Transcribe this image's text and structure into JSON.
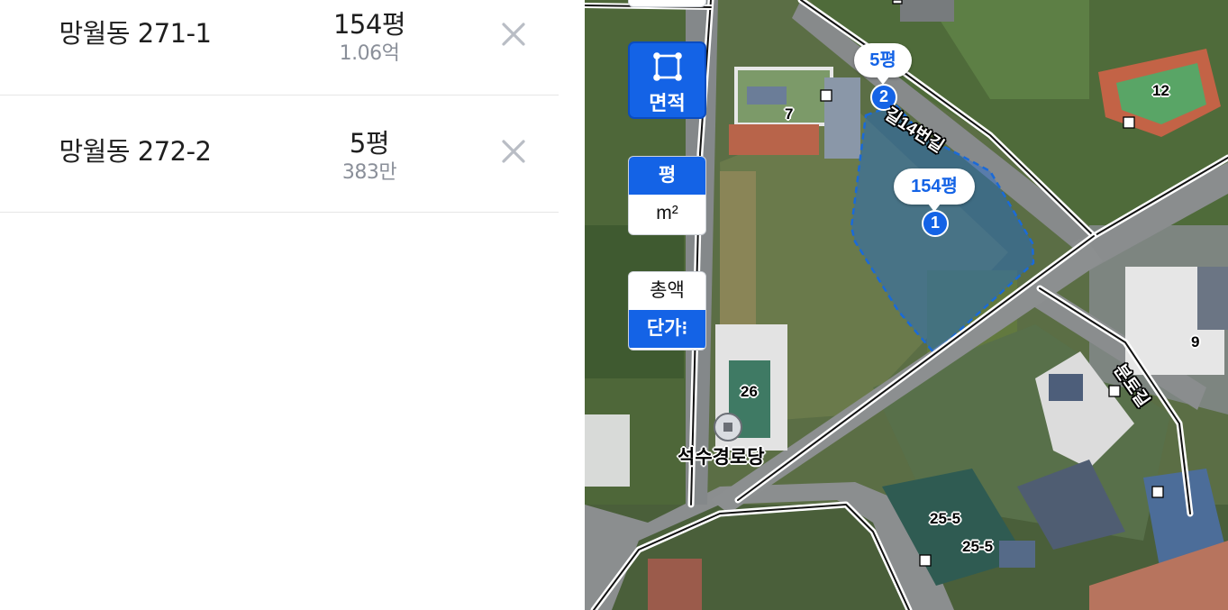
{
  "parcels": [
    {
      "address": "망월동 271-1",
      "area": "154평",
      "price": "1.06억"
    },
    {
      "address": "망월동 272-2",
      "area": "5평",
      "price": "383만"
    }
  ],
  "map_controls": {
    "area_tool_label": "면적",
    "unit_toggle": {
      "pyeong": "평",
      "sqm": "m²",
      "selected": "평"
    },
    "price_toggle": {
      "total": "총액",
      "unit_price": "단가⁝",
      "selected": "단가"
    }
  },
  "map": {
    "area_bubbles": [
      {
        "pin": "1",
        "label": "154평"
      },
      {
        "pin": "2",
        "label": "5평"
      }
    ],
    "building_numbers": [
      "12",
      "7",
      "9",
      "26",
      "25-5",
      "25-5"
    ],
    "poi": "석수경로당",
    "road_labels": [
      "길14번길",
      "분토길"
    ]
  },
  "colors": {
    "accent": "#1463e6",
    "parcel_fill": "#1a6ad8"
  }
}
